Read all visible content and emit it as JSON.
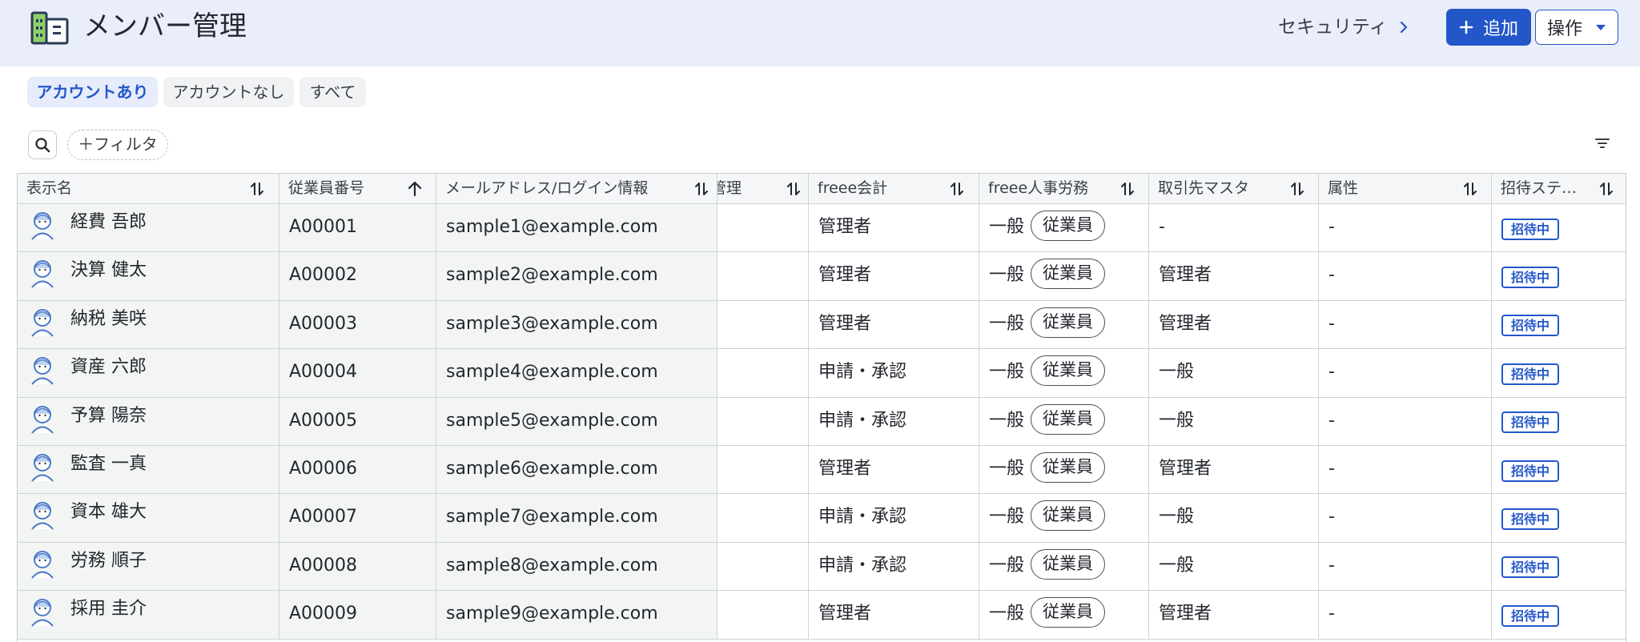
{
  "header": {
    "title": "メンバー管理",
    "security_link": "セキュリティ",
    "add_button": "追加",
    "ops_button": "操作"
  },
  "tabs": [
    {
      "label": "アカウントあり",
      "active": true
    },
    {
      "label": "アカウントなし",
      "active": false
    },
    {
      "label": "すべて",
      "active": false
    }
  ],
  "toolbar": {
    "filter_button": "＋フィルタ"
  },
  "table": {
    "columns": [
      {
        "label": "表示名",
        "sort": "both"
      },
      {
        "label": "従業員番号",
        "sort": "asc"
      },
      {
        "label": "メールアドレス/ログイン情報",
        "sort": "both"
      },
      {
        "label": "管理",
        "sort": "both"
      },
      {
        "label": "freee会計",
        "sort": "both"
      },
      {
        "label": "freee人事労務",
        "sort": "both"
      },
      {
        "label": "取引先マスタ",
        "sort": "both"
      },
      {
        "label": "属性",
        "sort": "both"
      },
      {
        "label": "招待ステ…",
        "sort": "both"
      }
    ],
    "rows": [
      {
        "name": "経費 吾郎",
        "emp_no": "A00001",
        "email": "sample1@example.com",
        "accounting": "管理者",
        "hr_role": "一般",
        "hr_chip": "従業員",
        "partner": "-",
        "attribute": "-",
        "status": "招待中",
        "avatar": "avatar-icon"
      },
      {
        "name": "決算 健太",
        "emp_no": "A00002",
        "email": "sample2@example.com",
        "accounting": "管理者",
        "hr_role": "一般",
        "hr_chip": "従業員",
        "partner": "管理者",
        "attribute": "-",
        "status": "招待中",
        "avatar": "avatar-icon"
      },
      {
        "name": "納税 美咲",
        "emp_no": "A00003",
        "email": "sample3@example.com",
        "accounting": "管理者",
        "hr_role": "一般",
        "hr_chip": "従業員",
        "partner": "管理者",
        "attribute": "-",
        "status": "招待中",
        "avatar": "avatar-icon"
      },
      {
        "name": "資産 六郎",
        "emp_no": "A00004",
        "email": "sample4@example.com",
        "accounting": "申請・承認",
        "hr_role": "一般",
        "hr_chip": "従業員",
        "partner": "一般",
        "attribute": "-",
        "status": "招待中",
        "avatar": "avatar-icon"
      },
      {
        "name": "予算 陽奈",
        "emp_no": "A00005",
        "email": "sample5@example.com",
        "accounting": "申請・承認",
        "hr_role": "一般",
        "hr_chip": "従業員",
        "partner": "一般",
        "attribute": "-",
        "status": "招待中",
        "avatar": "avatar-icon"
      },
      {
        "name": "監査 一真",
        "emp_no": "A00006",
        "email": "sample6@example.com",
        "accounting": "管理者",
        "hr_role": "一般",
        "hr_chip": "従業員",
        "partner": "管理者",
        "attribute": "-",
        "status": "招待中",
        "avatar": "avatar-icon"
      },
      {
        "name": "資本 雄大",
        "emp_no": "A00007",
        "email": "sample7@example.com",
        "accounting": "申請・承認",
        "hr_role": "一般",
        "hr_chip": "従業員",
        "partner": "一般",
        "attribute": "-",
        "status": "招待中",
        "avatar": "avatar-icon"
      },
      {
        "name": "労務 順子",
        "emp_no": "A00008",
        "email": "sample8@example.com",
        "accounting": "申請・承認",
        "hr_role": "一般",
        "hr_chip": "従業員",
        "partner": "一般",
        "attribute": "-",
        "status": "招待中",
        "avatar": "avatar-icon"
      },
      {
        "name": "採用 圭介",
        "emp_no": "A00009",
        "email": "sample9@example.com",
        "accounting": "管理者",
        "hr_role": "一般",
        "hr_chip": "従業員",
        "partner": "管理者",
        "attribute": "-",
        "status": "招待中",
        "avatar": "avatar-icon"
      }
    ]
  },
  "colors": {
    "accent": "#2357c9",
    "header_bg": "#e9eefa",
    "frozen_bg": "#f3f5f4"
  }
}
